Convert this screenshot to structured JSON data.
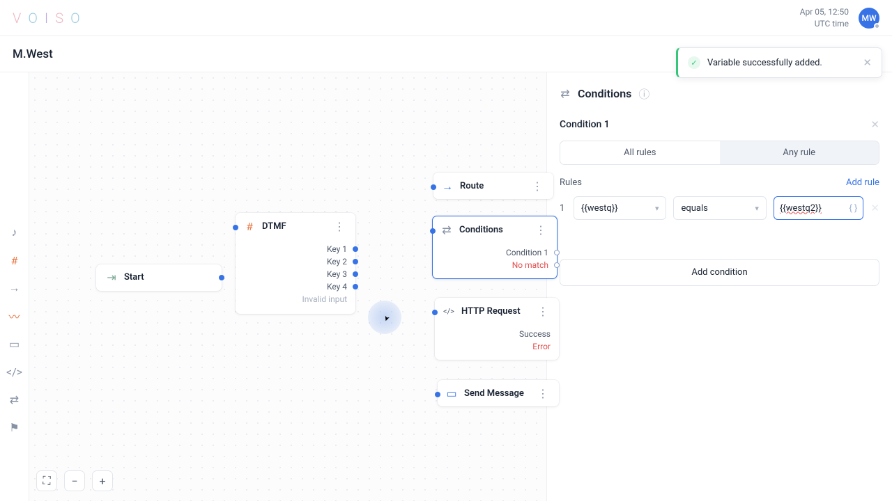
{
  "header": {
    "date": "Apr 05, 12:50",
    "tz": "UTC time",
    "avatar": "MW"
  },
  "subheader": {
    "title": "M.West"
  },
  "toast": {
    "message": "Variable successfully added."
  },
  "toolbar_icons": [
    "music-icon",
    "hash-icon",
    "arrow-icon",
    "signal-icon",
    "chat-icon",
    "code-icon",
    "branch-icon",
    "flag-icon"
  ],
  "canvas": {
    "start": {
      "label": "Start"
    },
    "dtmf": {
      "label": "DTMF",
      "keys": [
        "Key 1",
        "Key 2",
        "Key 3",
        "Key 4"
      ],
      "invalid": "Invalid input"
    },
    "route": {
      "label": "Route"
    },
    "conditions": {
      "label": "Conditions",
      "rows": [
        {
          "text": "Condition 1",
          "red": false
        },
        {
          "text": "No match",
          "red": true
        }
      ]
    },
    "http": {
      "label": "HTTP Request",
      "rows": [
        {
          "text": "Success",
          "red": false
        },
        {
          "text": "Error",
          "red": true
        }
      ]
    },
    "send": {
      "label": "Send Message"
    }
  },
  "panel": {
    "title": "Conditions",
    "condition_name": "Condition 1",
    "tabs": {
      "all": "All rules",
      "any": "Any rule"
    },
    "rules_label": "Rules",
    "add_rule": "Add rule",
    "rule": {
      "num": "1",
      "left": "{{westq}}",
      "op": "equals",
      "right": "{{westq2}}"
    },
    "add_condition": "Add condition"
  },
  "zoom": {
    "full": "⛶",
    "minus": "−",
    "plus": "+"
  }
}
